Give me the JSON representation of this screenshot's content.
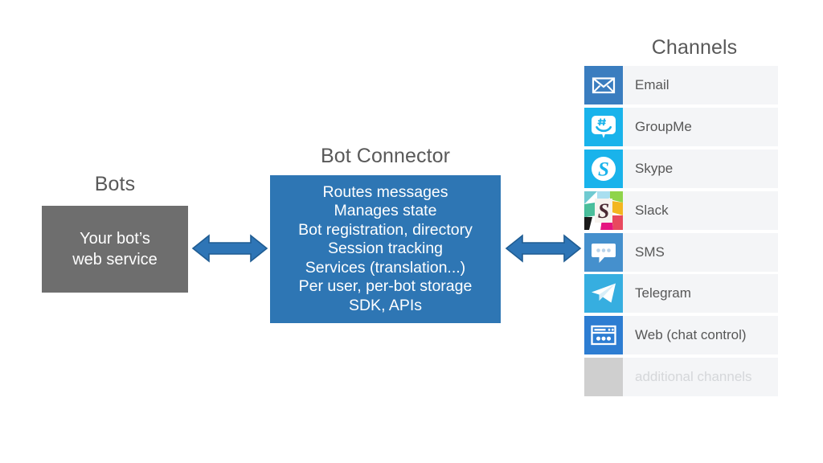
{
  "diagram": {
    "title_bots": "Bots",
    "title_connector": "Bot Connector",
    "title_channels": "Channels"
  },
  "bots": {
    "heading": "Bots",
    "box_text": "Your bot’s\nweb service",
    "box_color": "#6e6e6e",
    "text_color": "#ffffff"
  },
  "connector": {
    "heading": "Bot Connector",
    "box_color": "#2e76b4",
    "text_color": "#ffffff",
    "box_text": "Routes messages\nManages state\nBot registration, directory\nSession tracking\nServices (translation...)\nPer user, per-bot storage\nSDK, APIs",
    "lines": [
      "Routes messages",
      "Manages state",
      "Bot registration, directory",
      "Session tracking",
      "Services (translation...)",
      "Per user, per-bot storage",
      "SDK, APIs"
    ]
  },
  "arrows": {
    "fill": "#2e75b6",
    "stroke": "#1f5c92",
    "left": {
      "name": "bots-to-connector-arrow",
      "direction": "bidirectional"
    },
    "right": {
      "name": "connector-to-channels-arrow",
      "direction": "bidirectional"
    }
  },
  "channels": {
    "heading": "Channels",
    "row_background": "#f4f5f7",
    "items": [
      {
        "label": "Email",
        "icon": "email-icon",
        "tile_color": "#3a7dbf",
        "muted": false
      },
      {
        "label": "GroupMe",
        "icon": "groupme-icon",
        "tile_color": "#19b3eb",
        "muted": false
      },
      {
        "label": "Skype",
        "icon": "skype-icon",
        "tile_color": "#19b3eb",
        "muted": false
      },
      {
        "label": "Slack",
        "icon": "slack-icon",
        "tile_color": "#f4d03f",
        "muted": false
      },
      {
        "label": "SMS",
        "icon": "sms-icon",
        "tile_color": "#4590cd",
        "muted": false
      },
      {
        "label": "Telegram",
        "icon": "telegram-icon",
        "tile_color": "#36aee0",
        "muted": false
      },
      {
        "label": "Web (chat control)",
        "icon": "web-chat-icon",
        "tile_color": "#2d7dd2",
        "muted": false
      },
      {
        "label": "additional channels",
        "icon": "placeholder-icon",
        "tile_color": "#cfcfcf",
        "muted": true
      }
    ]
  }
}
